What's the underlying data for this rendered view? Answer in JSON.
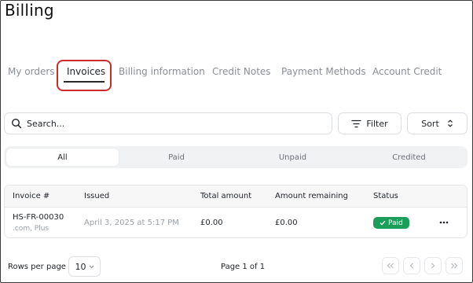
{
  "page": {
    "title": "Billing"
  },
  "tabs": [
    {
      "label": "My orders"
    },
    {
      "label": "Invoices"
    },
    {
      "label": "Billing information"
    },
    {
      "label": "Credit Notes"
    },
    {
      "label": "Payment Methods"
    },
    {
      "label": "Account Credit"
    }
  ],
  "active_tab": "Invoices",
  "search": {
    "placeholder": "Search...",
    "value": ""
  },
  "toolbar": {
    "filter_label": "Filter",
    "sort_label": "Sort"
  },
  "segments": {
    "items": [
      {
        "label": "All"
      },
      {
        "label": "Paid"
      },
      {
        "label": "Unpaid"
      },
      {
        "label": "Credited"
      }
    ],
    "active": "All"
  },
  "table": {
    "columns": [
      "Invoice #",
      "Issued",
      "Total amount",
      "Amount remaining",
      "Status"
    ],
    "rows": [
      {
        "invoice": "HS-FR-00030",
        "sub": ".com, Plus",
        "issued": "April 3, 2025 at 5:17 PM",
        "total": "£0.00",
        "remaining": "£0.00",
        "status": "Paid"
      }
    ]
  },
  "pagination": {
    "rows_per_page_label": "Rows per page",
    "rows_per_page": "10",
    "page_label": "Page 1 of 1"
  },
  "colors": {
    "accent_red": "#cc2b2b",
    "status_paid": "#1a9e5a"
  }
}
